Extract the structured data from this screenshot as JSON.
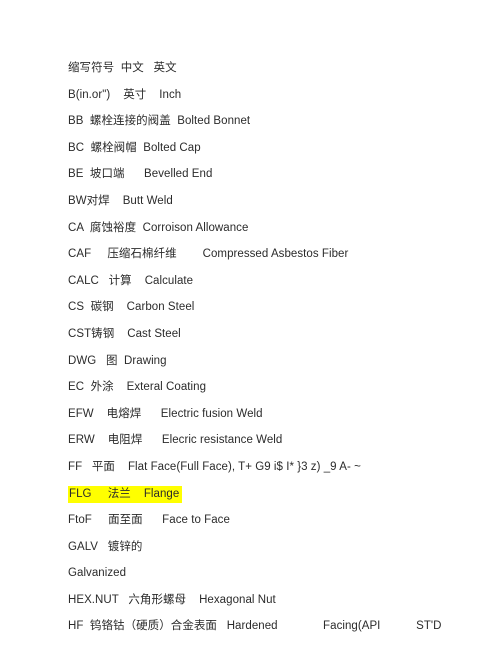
{
  "document": {
    "page_background": "#ffffff",
    "text_color": "#2b2b2b",
    "highlight_color": "#ffff00",
    "header_line": "缩写符号  中文   英文",
    "entries": [
      {
        "text": "缩写符号  中文   英文",
        "highlighted": false,
        "is_header": true
      },
      {
        "text": "B(in.or\")    英寸    Inch",
        "highlighted": false,
        "is_header": false
      },
      {
        "text": "BB  螺栓连接的阀盖  Bolted Bonnet",
        "highlighted": false,
        "is_header": false
      },
      {
        "text": "BC  螺栓阀帽  Bolted Cap",
        "highlighted": false,
        "is_header": false
      },
      {
        "text": "BE  坡口端      Bevelled End",
        "highlighted": false,
        "is_header": false
      },
      {
        "text": "BW对焊    Butt Weld",
        "highlighted": false,
        "is_header": false
      },
      {
        "text": "CA  腐蚀裕度  Corroison Allowance",
        "highlighted": false,
        "is_header": false
      },
      {
        "text": "CAF     压缩石棉纤维        Compressed Asbestos Fiber",
        "highlighted": false,
        "is_header": false
      },
      {
        "text": "CALC   计算    Calculate",
        "highlighted": false,
        "is_header": false
      },
      {
        "text": "CS  碳钢    Carbon Steel",
        "highlighted": false,
        "is_header": false
      },
      {
        "text": "CST铸钢    Cast Steel",
        "highlighted": false,
        "is_header": false
      },
      {
        "text": "DWG   图  Drawing",
        "highlighted": false,
        "is_header": false
      },
      {
        "text": "EC  外涂    Exteral Coating",
        "highlighted": false,
        "is_header": false
      },
      {
        "text": "EFW    电熔焊      Electric fusion Weld",
        "highlighted": false,
        "is_header": false
      },
      {
        "text": "ERW    电阻焊      Elecric resistance Weld",
        "highlighted": false,
        "is_header": false
      },
      {
        "text": "FF   平面    Flat Face(Full Face), T+ G9 i$ I* }3 z) _9 A- ~",
        "highlighted": false,
        "is_header": false
      },
      {
        "text": "FLG     法兰    Flange",
        "highlighted": true,
        "is_header": false
      },
      {
        "text": "FtoF     面至面      Face to Face",
        "highlighted": false,
        "is_header": false
      },
      {
        "text": "GALV   镀锌的",
        "highlighted": false,
        "is_header": false
      },
      {
        "text": "Galvanized",
        "highlighted": false,
        "is_header": false
      },
      {
        "text": "HEX.NUT   六角形螺母    Hexagonal Nut",
        "highlighted": false,
        "is_header": false
      },
      {
        "text": "HF  钨铬钴（硬质）合金表面   Hardened              Facing(API           ST'D",
        "highlighted": false,
        "is_header": false
      }
    ]
  }
}
